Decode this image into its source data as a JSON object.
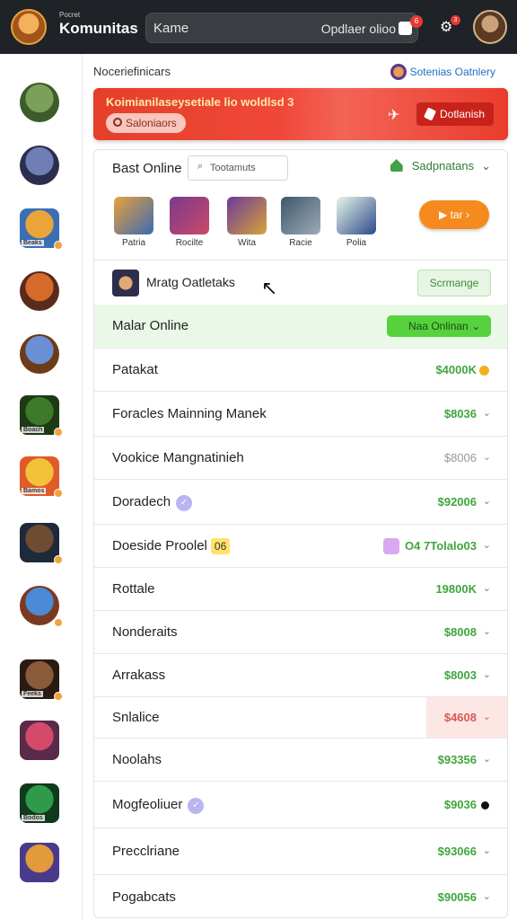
{
  "header": {
    "brand_small": "Pocret",
    "brand": "Komunitas",
    "search_placeholder": "Kame",
    "search_value": "Opdlaer olioo",
    "search_badge": "6",
    "gear_badge": "3"
  },
  "sidebar": {
    "items": [
      {
        "name": "sidebar-game-1",
        "caption": "",
        "colors": [
          "#7aa05a",
          "#3d5b2b"
        ]
      },
      {
        "name": "sidebar-game-2",
        "caption": "",
        "colors": [
          "#6f7fb5",
          "#2a2f50"
        ]
      },
      {
        "name": "sidebar-game-3",
        "caption": "Beaks",
        "colors": [
          "#e9a43a",
          "#3b6fb3"
        ]
      },
      {
        "name": "sidebar-game-4",
        "caption": "",
        "colors": [
          "#d46b2a",
          "#5a2a1a"
        ]
      },
      {
        "name": "sidebar-game-5",
        "caption": "",
        "colors": [
          "#6a8fd2",
          "#6b3b1a"
        ]
      },
      {
        "name": "sidebar-game-6",
        "caption": "Boach",
        "colors": [
          "#3c7a2a",
          "#1e3a14"
        ]
      },
      {
        "name": "sidebar-game-7",
        "caption": "Bamos",
        "colors": [
          "#f1c23a",
          "#e05a2a"
        ]
      },
      {
        "name": "sidebar-game-8",
        "caption": "",
        "colors": [
          "#6e4c32",
          "#1e2a3a"
        ]
      },
      {
        "name": "sidebar-game-9",
        "caption": "",
        "colors": [
          "#4a8ad6",
          "#7a3a22"
        ]
      },
      {
        "name": "sidebar-game-10",
        "caption": "Feeks",
        "colors": [
          "#8a5a3a",
          "#2a1a14"
        ]
      },
      {
        "name": "sidebar-game-11",
        "caption": "",
        "colors": [
          "#d44a6a",
          "#5a2a4a"
        ]
      },
      {
        "name": "sidebar-game-12",
        "caption": "Bodos",
        "colors": [
          "#2f9a4a",
          "#0f3a1e"
        ]
      },
      {
        "name": "sidebar-game-13",
        "caption": "",
        "colors": [
          "#e39a3a",
          "#4a3a8a"
        ]
      }
    ]
  },
  "main": {
    "top_left": "Noceriefinicars",
    "top_right": "Sotenias Oatnlery",
    "banner": {
      "title": "Koimianilaseysetiale lio woldlsd 3",
      "pill": "Saloniaors",
      "button": "Dotlanish"
    },
    "best_online": "Bast Online",
    "filter": "Tootamuts",
    "sort": "Sadpnatans",
    "games": [
      {
        "label": "Patria",
        "colors": [
          "#e8a23a",
          "#3b6ab3"
        ]
      },
      {
        "label": "Rocilte",
        "colors": [
          "#7a3a8a",
          "#c94a6a"
        ]
      },
      {
        "label": "Wita",
        "colors": [
          "#6a3a9a",
          "#d9a33a"
        ]
      },
      {
        "label": "Racie",
        "colors": [
          "#3a5a6a",
          "#a0a8b8"
        ]
      },
      {
        "label": "Polia",
        "colors": [
          "#eaf6ea",
          "#2a4a8a"
        ]
      }
    ],
    "play_button": "▶ tar ›",
    "ops_title": "Mratg Oatletaks",
    "ops_button": "Scrmange",
    "market_header": "Malar Online",
    "market_button": "Naa Onlinan",
    "rows": [
      {
        "name": "Patakat",
        "value": "$4000K",
        "tail": "coin",
        "style": "green"
      },
      {
        "name": "Foracles Mainning Manek",
        "value": "$8036",
        "tail": "chevron",
        "style": "green"
      },
      {
        "name": "Vookice Mangnatinieh",
        "value": "$8006",
        "tail": "chevron",
        "style": "gray"
      },
      {
        "name": "Doradech",
        "value": "$92006",
        "tail": "chevron",
        "style": "green",
        "badge": "v"
      },
      {
        "name": "Doeside Proolel",
        "value": "O4 7Tolalo03",
        "tail": "chevron",
        "style": "green",
        "badge_text": "06",
        "pico": true
      },
      {
        "name": "Rottale",
        "value": "19800K",
        "tail": "chevron",
        "style": "green"
      },
      {
        "name": "Nonderaits",
        "value": "$8008",
        "tail": "chevron",
        "style": "green"
      },
      {
        "name": "Arrakass",
        "value": "$8003",
        "tail": "chevron",
        "style": "green"
      },
      {
        "name": "Snlalice",
        "value": "$4608",
        "tail": "chevron",
        "style": "red"
      },
      {
        "name": "Noolahs",
        "value": "$93356",
        "tail": "chevron",
        "style": "green"
      },
      {
        "name": "Mogfeoliuer",
        "value": "$9036",
        "tail": "dot",
        "style": "green",
        "badge": "v"
      },
      {
        "name": "Precclriane",
        "value": "$93066",
        "tail": "chevron",
        "style": "green"
      },
      {
        "name": "Pogabcats",
        "value": "$90056",
        "tail": "chevron",
        "style": "green"
      }
    ]
  }
}
